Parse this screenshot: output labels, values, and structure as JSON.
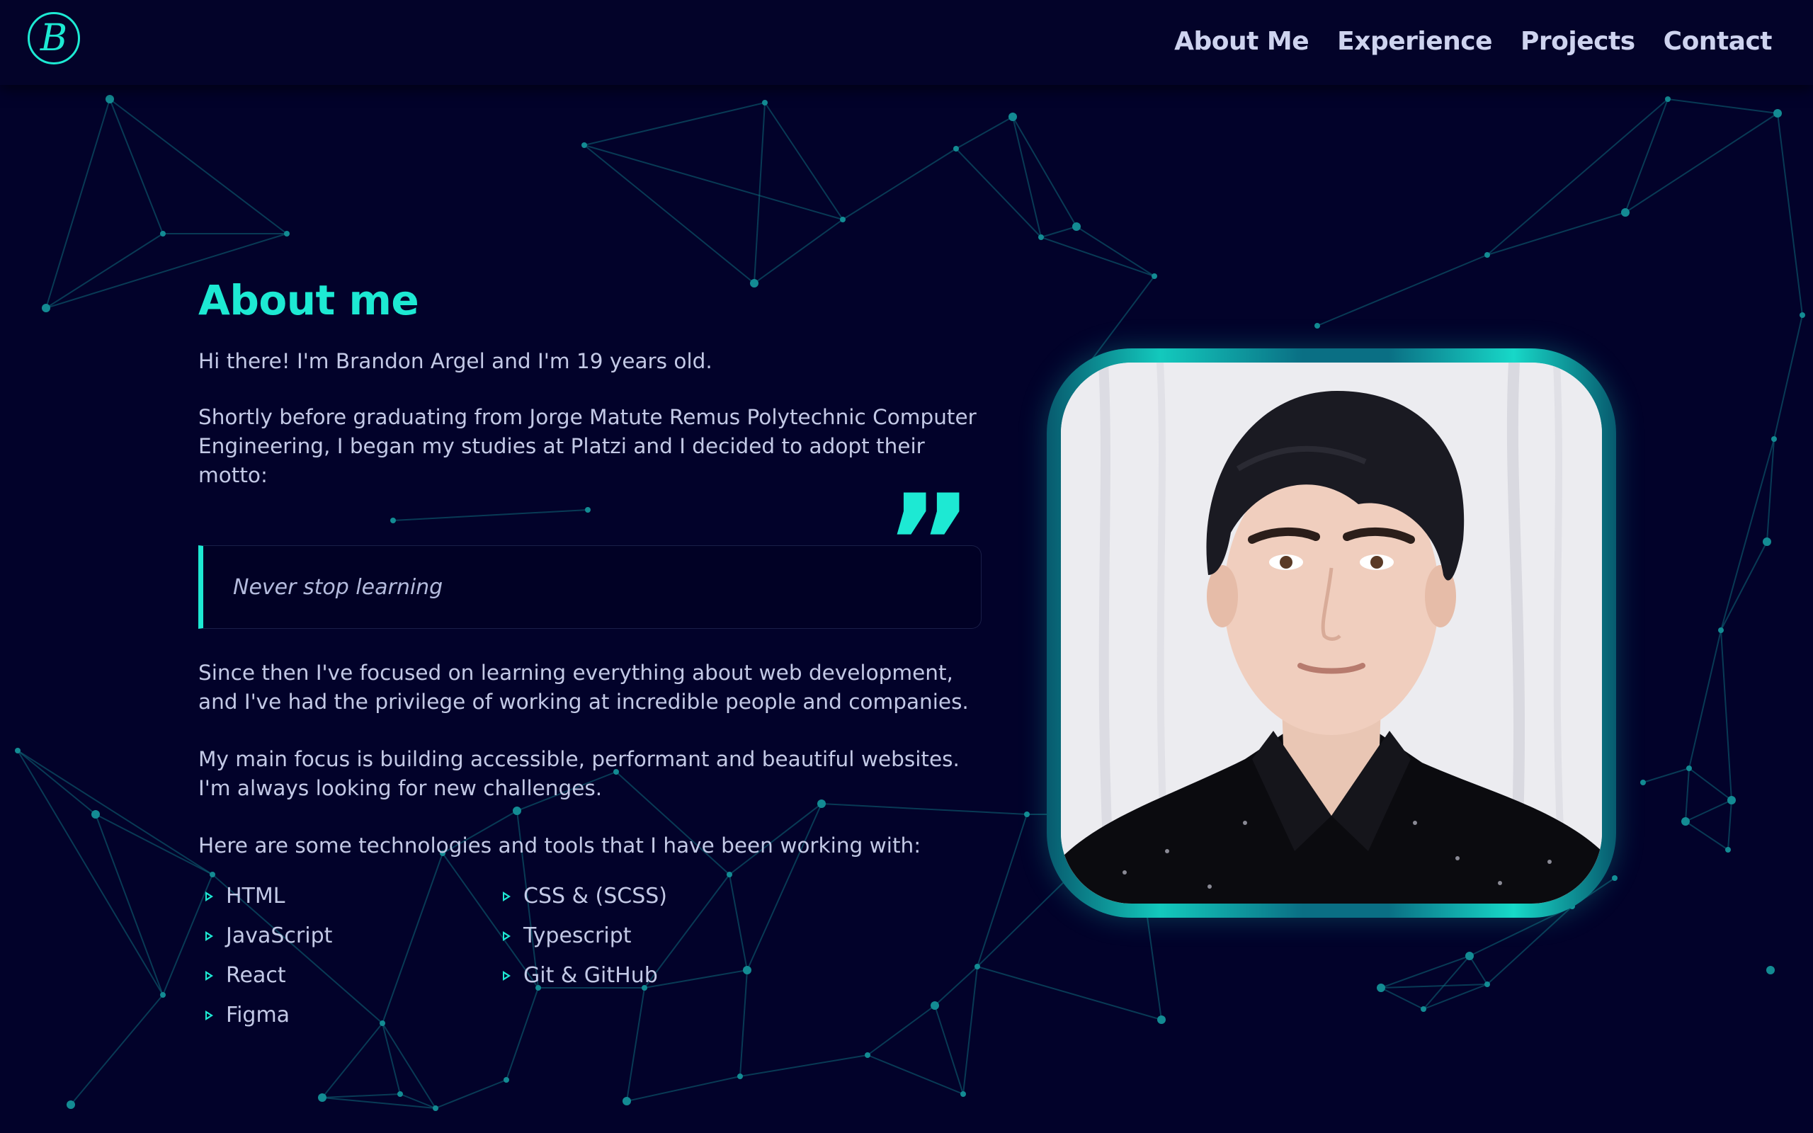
{
  "header": {
    "logo_letter": "B",
    "nav": [
      "About Me",
      "Experience",
      "Projects",
      "Contact"
    ]
  },
  "about": {
    "title": "About me",
    "intro": "Hi there! I'm Brandon Argel and I'm 19 years old.",
    "paragraph2": "Shortly before graduating from Jorge Matute Remus Polytechnic Computer Engineering, I began my studies at Platzi and I decided to adopt their motto:",
    "quote": "Never stop learning",
    "quote_mark": "”",
    "paragraph3": "Since then I've focused on learning everything about web development, and I've had the privilege of working at incredible people and companies.",
    "paragraph4": "My main focus is building accessible, performant and beautiful websites. I'm always looking for new challenges.",
    "paragraph5": "Here are some technologies and tools that I have been working with:",
    "technologies": [
      "HTML",
      "CSS & (SCSS)",
      "JavaScript",
      "Typescript",
      "React",
      "Git & GitHub",
      "Figma"
    ]
  },
  "colors": {
    "background": "#02022a",
    "accent": "#1de9d3",
    "text": "#c3c9e6"
  }
}
